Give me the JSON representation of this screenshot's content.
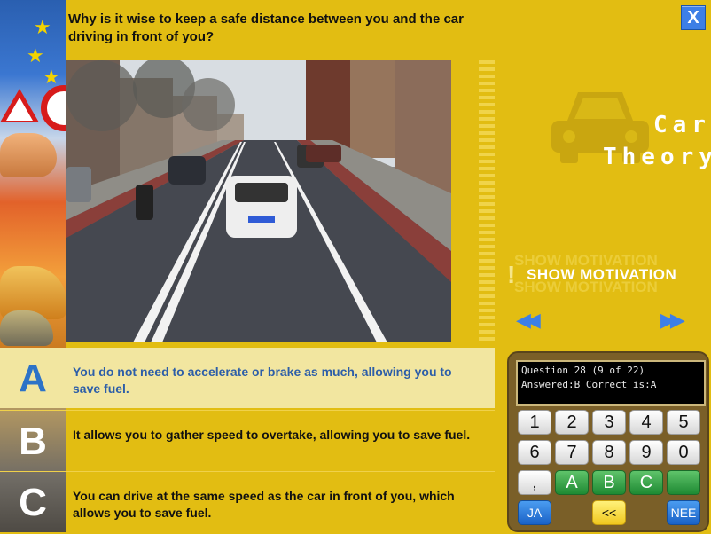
{
  "question": {
    "text": "Why is it wise to keep a safe distance between you and the car driving in front of you?",
    "close_label": "X"
  },
  "logo": {
    "line1": "Car",
    "line2": "Theory",
    "car_icon": "car-icon"
  },
  "motivation": {
    "label": "SHOW MOTIVATION",
    "icon": "exclamation-icon"
  },
  "navigation": {
    "prev_label": "◀◀",
    "next_label": "▶▶"
  },
  "answers": [
    {
      "letter": "A",
      "text": "You do not need to accelerate or brake as much, allowing you to save fuel."
    },
    {
      "letter": "B",
      "text": "It allows you to gather speed to overtake, allowing you to save fuel."
    },
    {
      "letter": "C",
      "text": "You can drive at the same speed as the car in front of you, which allows you to save fuel."
    }
  ],
  "keypad": {
    "lcd_line1": "Question 28 (9 of 22)",
    "lcd_line2": "Answered:B Correct is:A",
    "digits_row1": [
      "1",
      "2",
      "3",
      "4",
      "5"
    ],
    "digits_row2": [
      "6",
      "7",
      "8",
      "9",
      "0"
    ],
    "letter_row": [
      ",",
      "A",
      "B",
      "C",
      ""
    ],
    "yes_label": "JA",
    "back_label": "<<",
    "no_label": "NEE"
  },
  "colors": {
    "background": "#e2bd12",
    "selected_answer_bg": "#f2e6a0",
    "selected_answer_text": "#2d5ea8",
    "accent_blue": "#3d7fe6"
  }
}
